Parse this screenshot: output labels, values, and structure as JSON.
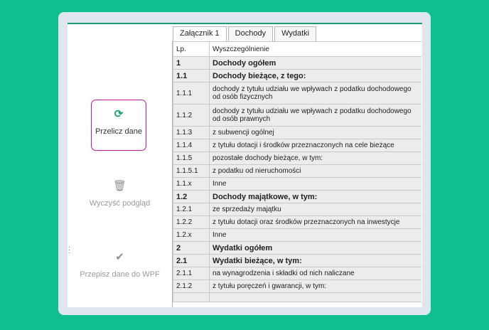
{
  "actions": {
    "recalculate": "Przelicz dane",
    "clear_preview": "Wyczyść podgląd",
    "copy_to_wpf": "Przepisz dane do WPF"
  },
  "tabs": [
    "Załącznik 1",
    "Dochody",
    "Wydatki"
  ],
  "table": {
    "headers": [
      "Lp.",
      "Wyszczególnienie"
    ],
    "rows": [
      {
        "lp": "1",
        "desc": "Dochody ogółem",
        "bold": true
      },
      {
        "lp": "1.1",
        "desc": "Dochody bieżące, z tego:",
        "bold": true
      },
      {
        "lp": "1.1.1",
        "desc": "dochody z tytułu udziału we wpływach z podatku dochodowego od osób fizycznych",
        "tall": true
      },
      {
        "lp": "1.1.2",
        "desc": "dochody z tytułu udziału we wpływach z podatku dochodowego od osób prawnych",
        "tall": true
      },
      {
        "lp": "1.1.3",
        "desc": "z subwencji ogólnej"
      },
      {
        "lp": "1.1.4",
        "desc": "z tytułu dotacji i środków przeznaczonych na cele bieżące"
      },
      {
        "lp": "1.1.5",
        "desc": "pozostałe dochody bieżące, w tym:"
      },
      {
        "lp": "1.1.5.1",
        "desc": "z podatku od nieruchomości"
      },
      {
        "lp": "1.1.x",
        "desc": "Inne"
      },
      {
        "lp": "1.2",
        "desc": "Dochody majątkowe, w tym:",
        "bold": true
      },
      {
        "lp": "1.2.1",
        "desc": "ze sprzedaży majątku"
      },
      {
        "lp": "1.2.2",
        "desc": "z tytułu dotacji oraz środków przeznaczonych na inwestycje"
      },
      {
        "lp": "1.2.x",
        "desc": "Inne"
      },
      {
        "lp": "2",
        "desc": "Wydatki ogółem",
        "bold": true
      },
      {
        "lp": "2.1",
        "desc": "Wydatki bieżące, w tym:",
        "bold": true
      },
      {
        "lp": "2.1.1",
        "desc": "na wynagrodzenia i składki od nich naliczane"
      },
      {
        "lp": "2.1.2",
        "desc": "z tytułu poręczeń i gwarancji, w tym:"
      }
    ]
  }
}
